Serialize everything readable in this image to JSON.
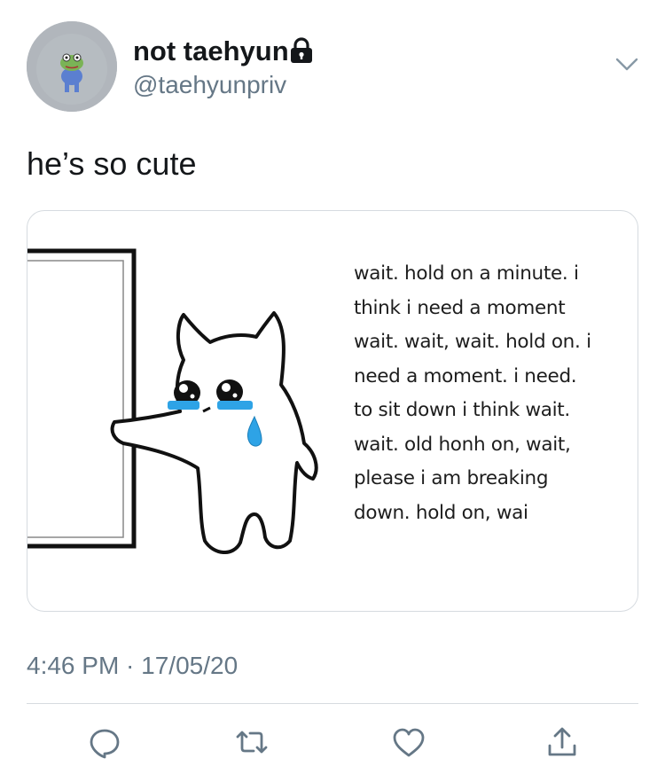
{
  "tweet": {
    "display_name": "not taehyun",
    "handle": "@taehyunpriv",
    "text": "he’s so cute",
    "timestamp": "4:46 PM · 17/05/20",
    "protected_icon": "lock-icon",
    "menu_icon": "chevron-down-icon"
  },
  "media": {
    "lines": [
      "wait. hold on a minute. i",
      "think i need a moment",
      "wait. wait, wait. hold on. i",
      "need a moment. i need.",
      "to sit down i think wait.",
      "wait. old honh on, wait,",
      "please i am breaking",
      "down. hold on, wai"
    ]
  },
  "actions": [
    {
      "name": "reply",
      "icon": "reply-icon"
    },
    {
      "name": "retweet",
      "icon": "retweet-icon"
    },
    {
      "name": "like",
      "icon": "heart-icon"
    },
    {
      "name": "share",
      "icon": "share-icon"
    }
  ],
  "colors": {
    "text": "#14171a",
    "secondary_text": "#657786",
    "border": "#d6dbe0",
    "tear_blue": "#2ea3e6"
  }
}
